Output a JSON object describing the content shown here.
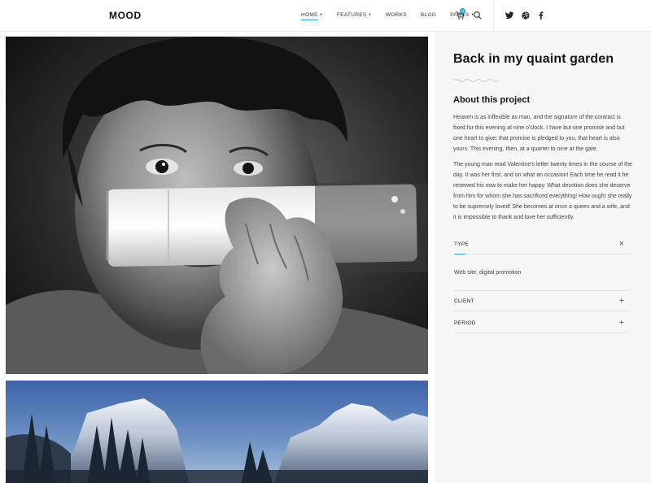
{
  "header": {
    "logo": "MOOD",
    "nav": [
      {
        "label": "HOME",
        "has_caret": true,
        "active": true
      },
      {
        "label": "FEATURES",
        "has_caret": true,
        "active": false
      },
      {
        "label": "WORKS",
        "has_caret": false,
        "active": false
      },
      {
        "label": "BLOG",
        "has_caret": false,
        "active": false
      },
      {
        "label": "PAGES",
        "has_caret": true,
        "active": false
      }
    ],
    "cart_count": "0",
    "icons": [
      "cart-icon",
      "search-icon",
      "twitter-icon",
      "dribbble-icon",
      "facebook-icon"
    ]
  },
  "project": {
    "title": "Back in my quaint garden",
    "about_title": "About this project",
    "paragraphs": [
      "Heaven is as inflexible as man, and the signature of the contract is fixed for this evening at nine o'clock. I have but one promise and but one heart to give; that promise is pledged to you, that heart is also yours. This evening, then, at a quarter to nine at the gate.",
      "The young man read Valentine's letter twenty times in the course of the day. It was her first, and on what an occasion! Each time he read it he renewed his vow to make her happy. What devotion does she deserve from him for whom she has sacrificed everything! How ought she really to be supremely loved! She becomes at once a queen and a wife, and it is impossible to thank and love her sufficiently."
    ],
    "details": [
      {
        "label": "TYPE",
        "icon": "×",
        "expanded": true,
        "value": "Web site, digital promotion"
      },
      {
        "label": "CLIENT",
        "icon": "+",
        "expanded": false
      },
      {
        "label": "PERIOD",
        "icon": "+",
        "expanded": false
      }
    ]
  },
  "colors": {
    "accent": "#2aa3d8",
    "sidebar_bg": "#f7f7f7"
  }
}
